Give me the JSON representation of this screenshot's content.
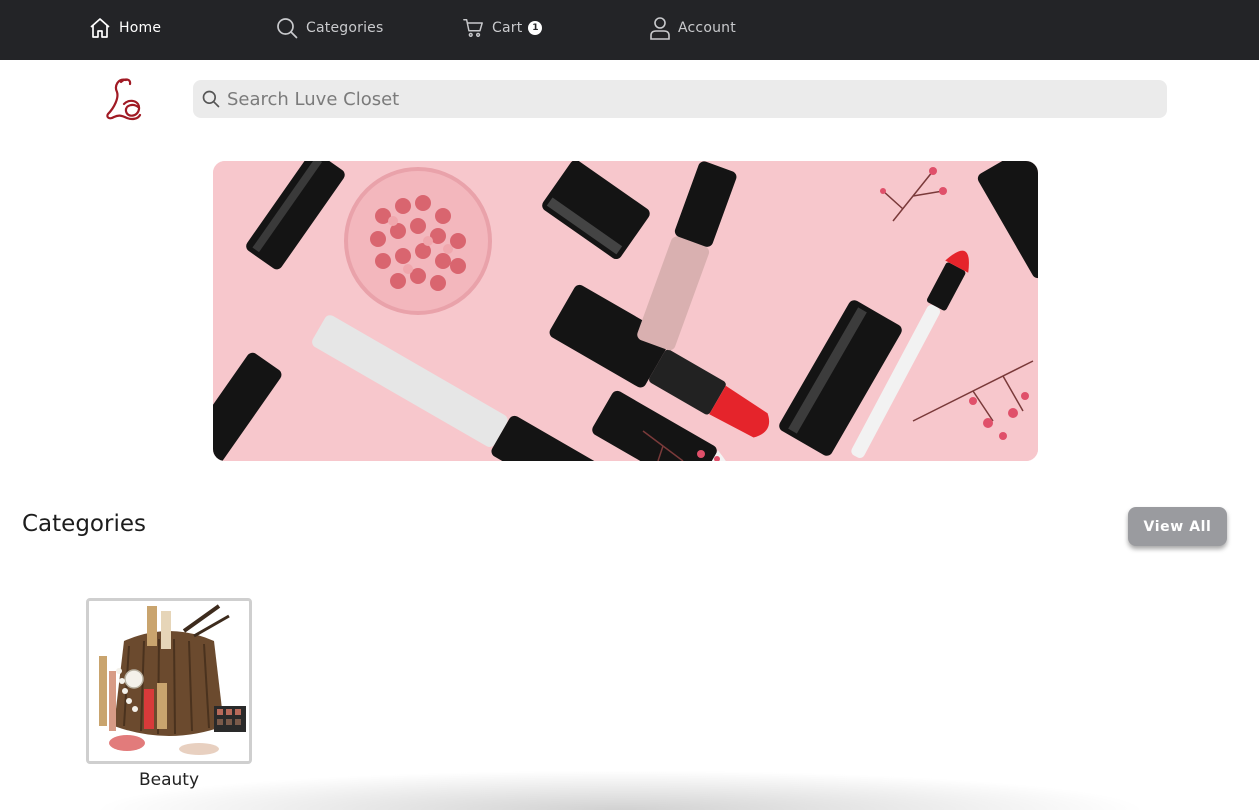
{
  "nav": {
    "home_label": "Home",
    "categories_label": "Categories",
    "cart_label": "Cart",
    "cart_count": "1",
    "account_label": "Account"
  },
  "brand": {
    "logo_icon": "luve-closet-monogram-logo",
    "logo_color": "#a01a24"
  },
  "search": {
    "placeholder": "Search Luve Closet",
    "value": ""
  },
  "hero": {
    "image": "pink-makeup-flatlay-banner"
  },
  "categories_section": {
    "title": "Categories",
    "view_all_label": "View All",
    "items": [
      {
        "label": "Beauty",
        "image": "beauty-cosmetics-bag"
      }
    ]
  },
  "colors": {
    "topbar": "#232427",
    "view_all_button": "#9a9b9f",
    "search_bg": "#ebebeb"
  }
}
